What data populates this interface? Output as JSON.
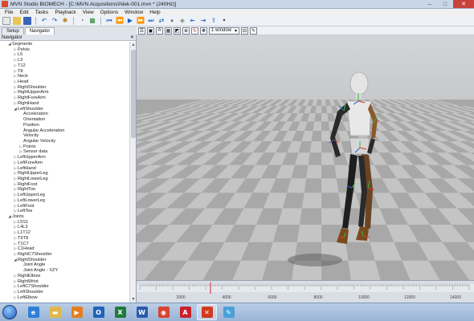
{
  "window": {
    "title": "MVN Studio BIOMECH - [C:\\MVN Acquisitions\\Niek-001.mvn * (240Hz)]",
    "minimize": "–",
    "maximize": "□",
    "close": "✕"
  },
  "menu": [
    "File",
    "Edit",
    "Tasks",
    "Playback",
    "View",
    "Options",
    "Window",
    "Help"
  ],
  "tabs": [
    "Setup",
    "Navigator"
  ],
  "viewport_toolbar": {
    "window_select": "1 window"
  },
  "navigator": {
    "title": "Navigator",
    "close": "✕",
    "tree": [
      {
        "label": "Segments",
        "depth": 1,
        "toggle": "◢"
      },
      {
        "label": "Pelvis",
        "depth": 2,
        "toggle": "▷"
      },
      {
        "label": "L5",
        "depth": 2,
        "toggle": "▷"
      },
      {
        "label": "L3",
        "depth": 2,
        "toggle": "▷"
      },
      {
        "label": "T12",
        "depth": 2,
        "toggle": "▷"
      },
      {
        "label": "T8",
        "depth": 2,
        "toggle": "▷"
      },
      {
        "label": "Neck",
        "depth": 2,
        "toggle": "▷"
      },
      {
        "label": "Head",
        "depth": 2,
        "toggle": "▷"
      },
      {
        "label": "RightShoulder",
        "depth": 2,
        "toggle": "▷"
      },
      {
        "label": "RightUpperArm",
        "depth": 2,
        "toggle": "▷"
      },
      {
        "label": "RightForeArm",
        "depth": 2,
        "toggle": "▷"
      },
      {
        "label": "RightHand",
        "depth": 2,
        "toggle": "▷"
      },
      {
        "label": "LeftShoulder",
        "depth": 2,
        "toggle": "◢"
      },
      {
        "label": "Acceleration",
        "depth": 3,
        "toggle": ""
      },
      {
        "label": "Orientation",
        "depth": 3,
        "toggle": ""
      },
      {
        "label": "Position",
        "depth": 3,
        "toggle": ""
      },
      {
        "label": "Angular Acceleration",
        "depth": 3,
        "toggle": ""
      },
      {
        "label": "Velocity",
        "depth": 3,
        "toggle": ""
      },
      {
        "label": "Angular Velocity",
        "depth": 3,
        "toggle": ""
      },
      {
        "label": "Points",
        "depth": 3,
        "toggle": "▷"
      },
      {
        "label": "Sensor data",
        "depth": 3,
        "toggle": "▷"
      },
      {
        "label": "LeftUpperArm",
        "depth": 2,
        "toggle": "▷"
      },
      {
        "label": "LeftForeArm",
        "depth": 2,
        "toggle": "▷"
      },
      {
        "label": "LeftHand",
        "depth": 2,
        "toggle": "▷"
      },
      {
        "label": "RightUpperLeg",
        "depth": 2,
        "toggle": "▷"
      },
      {
        "label": "RightLowerLeg",
        "depth": 2,
        "toggle": "▷"
      },
      {
        "label": "RightFoot",
        "depth": 2,
        "toggle": "▷"
      },
      {
        "label": "RightToe",
        "depth": 2,
        "toggle": "▷"
      },
      {
        "label": "LeftUpperLeg",
        "depth": 2,
        "toggle": "▷"
      },
      {
        "label": "LeftLowerLeg",
        "depth": 2,
        "toggle": "▷"
      },
      {
        "label": "LeftFoot",
        "depth": 2,
        "toggle": "▷"
      },
      {
        "label": "LeftToe",
        "depth": 2,
        "toggle": "▷"
      },
      {
        "label": "Joints",
        "depth": 1,
        "toggle": "◢"
      },
      {
        "label": "L5S1",
        "depth": 2,
        "toggle": "▷"
      },
      {
        "label": "L4L3",
        "depth": 2,
        "toggle": "▷"
      },
      {
        "label": "L1T12",
        "depth": 2,
        "toggle": "▷"
      },
      {
        "label": "T9T8",
        "depth": 2,
        "toggle": "▷"
      },
      {
        "label": "T1C7",
        "depth": 2,
        "toggle": "▷"
      },
      {
        "label": "C1Head",
        "depth": 2,
        "toggle": "▷"
      },
      {
        "label": "RightC7Shoulder",
        "depth": 2,
        "toggle": "▷"
      },
      {
        "label": "RightShoulder",
        "depth": 2,
        "toggle": "◢"
      },
      {
        "label": "Joint Angle",
        "depth": 3,
        "toggle": ""
      },
      {
        "label": "Joint Angle - XZY",
        "depth": 3,
        "toggle": ""
      },
      {
        "label": "RightElbow",
        "depth": 2,
        "toggle": "▷"
      },
      {
        "label": "RightWrist",
        "depth": 2,
        "toggle": "▷"
      },
      {
        "label": "LeftC7Shoulder",
        "depth": 2,
        "toggle": "▷"
      },
      {
        "label": "LeftShoulder",
        "depth": 2,
        "toggle": "▷"
      },
      {
        "label": "LeftElbow",
        "depth": 2,
        "toggle": "▷"
      }
    ]
  },
  "timeline": {
    "ticks": [
      "2000",
      "4000",
      "6000",
      "8000",
      "10000",
      "12000",
      "14000"
    ]
  },
  "taskbar_apps": [
    {
      "name": "internet-explorer-icon",
      "color": "#2d7fd6",
      "glyph": "e"
    },
    {
      "name": "file-explorer-icon",
      "color": "#e0b84a",
      "glyph": "▬"
    },
    {
      "name": "media-player-icon",
      "color": "#e57d1c",
      "glyph": "▶"
    },
    {
      "name": "outlook-icon",
      "color": "#1e63b8",
      "glyph": "O"
    },
    {
      "name": "excel-icon",
      "color": "#1f7a3c",
      "glyph": "X"
    },
    {
      "name": "word-icon",
      "color": "#2a5ba8",
      "glyph": "W"
    },
    {
      "name": "chrome-icon",
      "color": "#d8432f",
      "glyph": "◉"
    },
    {
      "name": "pdf-icon",
      "color": "#c8202a",
      "glyph": "A"
    },
    {
      "name": "mvn-studio-icon",
      "color": "#d23a1e",
      "glyph": "✕"
    },
    {
      "name": "paint-icon",
      "color": "#4aa0d8",
      "glyph": "✎"
    }
  ]
}
